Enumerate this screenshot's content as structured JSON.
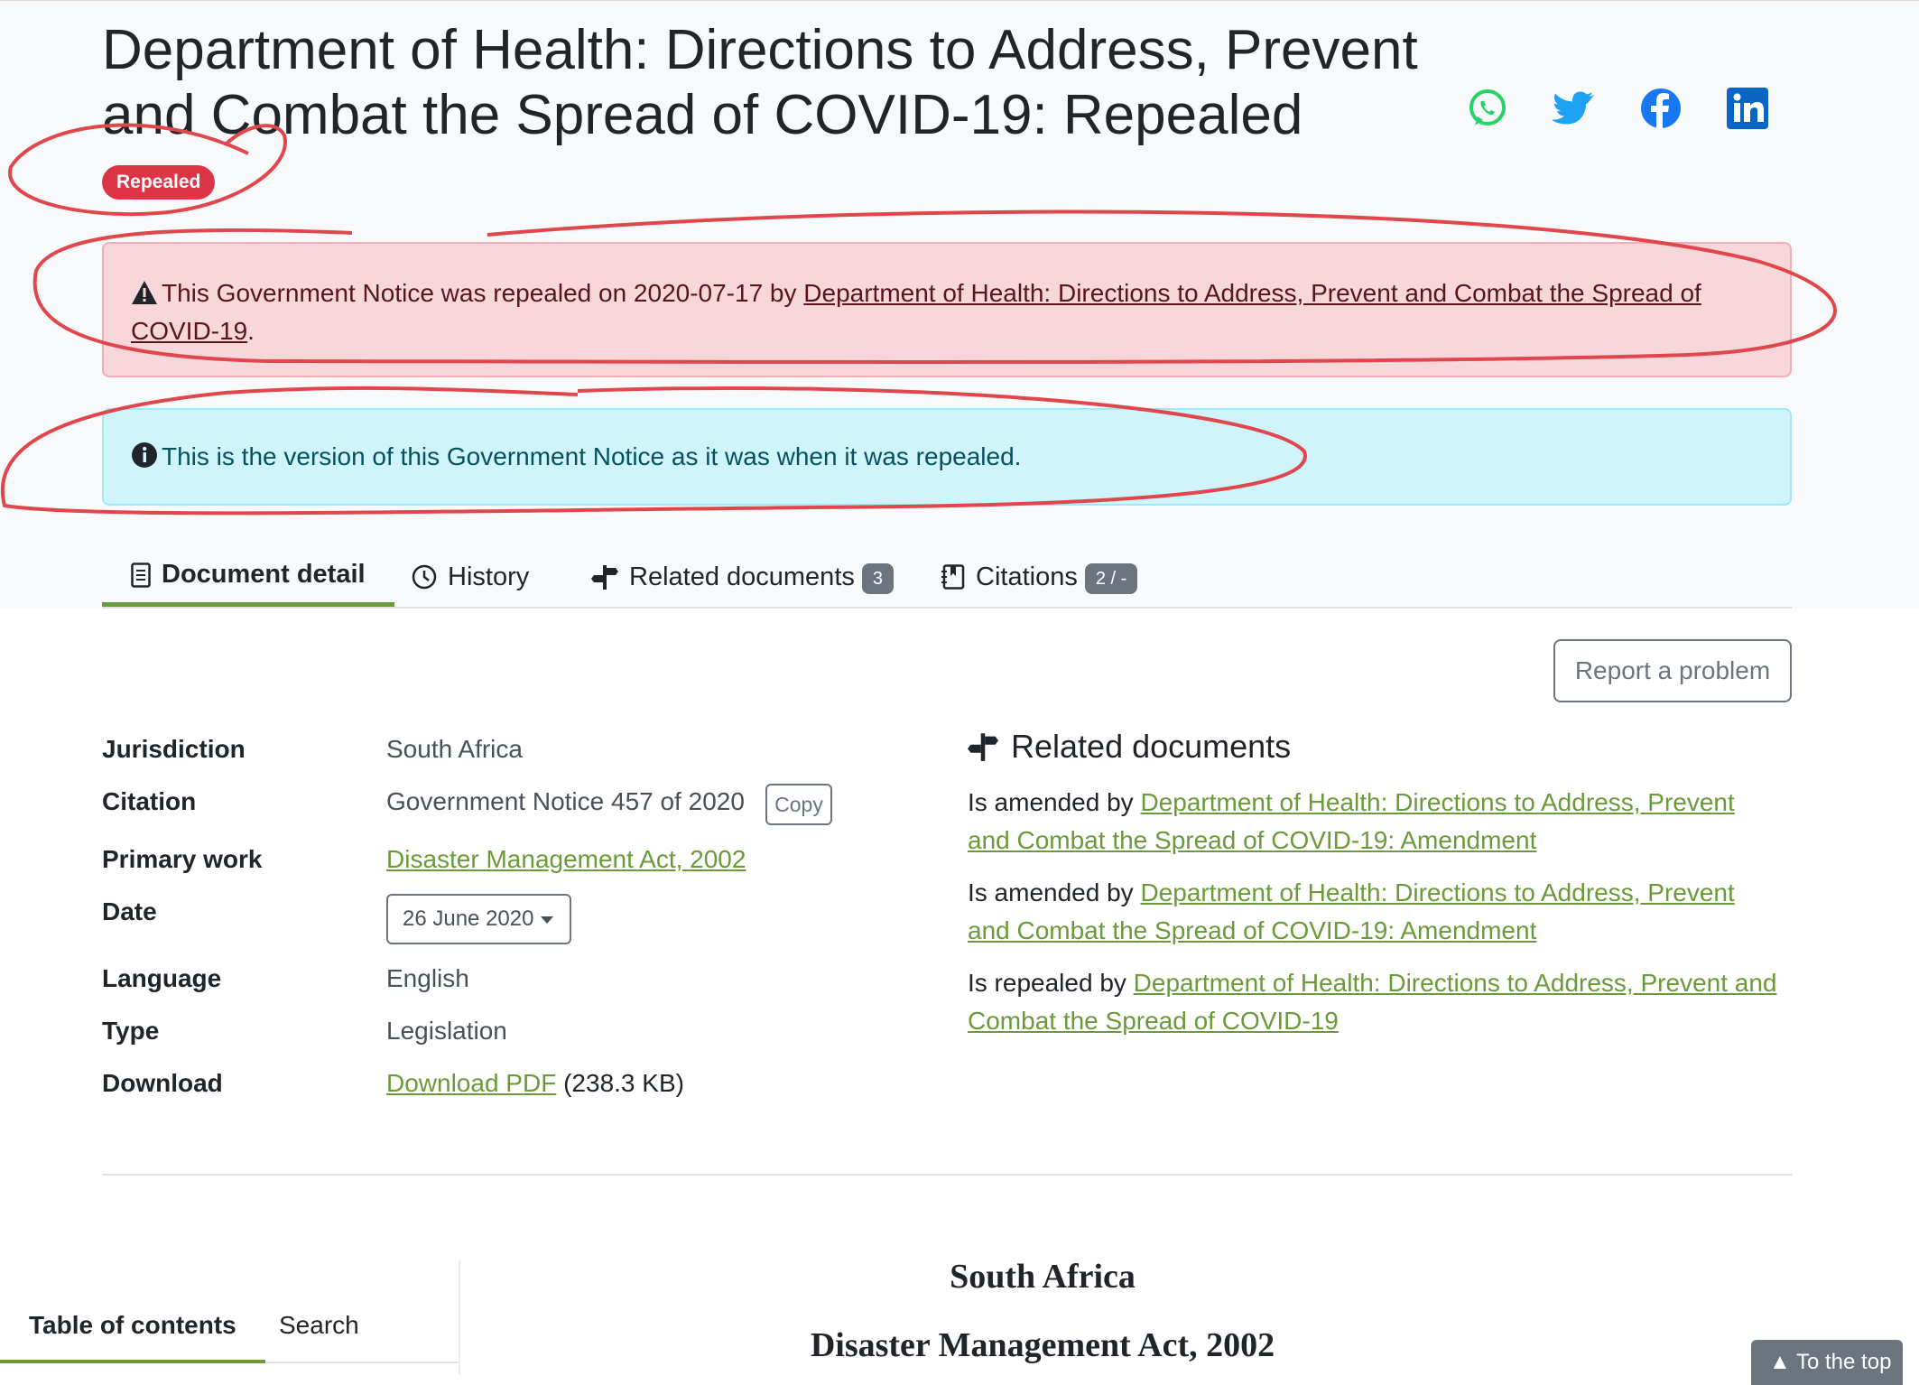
{
  "header": {
    "title": "Department of Health: Directions to Address, Prevent and Combat the Spread of COVID-19: Repealed",
    "status_badge": "Repealed"
  },
  "share": {
    "icons": [
      "whatsapp-icon",
      "twitter-icon",
      "facebook-icon",
      "linkedin-icon"
    ],
    "colors": {
      "whatsapp": "#25d366",
      "twitter": "#1da1f2",
      "facebook": "#1877f2",
      "linkedin": "#0a66c2"
    }
  },
  "alerts": {
    "repealed_prefix": "This Government Notice was repealed on 2020-07-17 by ",
    "repealed_link": "Department of Health: Directions to Address, Prevent and Combat the Spread of COVID-19",
    "repealed_suffix": ".",
    "version_info": "This is the version of this Government Notice as it was when it was repealed."
  },
  "tabs": [
    {
      "label": "Document detail",
      "icon": "document-icon",
      "active": true
    },
    {
      "label": "History",
      "icon": "clock-icon"
    },
    {
      "label": "Related documents",
      "icon": "signpost-icon",
      "count": "3"
    },
    {
      "label": "Citations",
      "icon": "journal-icon",
      "count": "2 / -"
    }
  ],
  "report_button": "Report a problem",
  "details": {
    "jurisdiction_label": "Jurisdiction",
    "jurisdiction": "South Africa",
    "citation_label": "Citation",
    "citation": "Government Notice 457 of 2020",
    "copy_button": "Copy",
    "primary_work_label": "Primary work",
    "primary_work": "Disaster Management Act, 2002",
    "date_label": "Date",
    "date": "26 June 2020",
    "language_label": "Language",
    "language": "English",
    "type_label": "Type",
    "type": "Legislation",
    "download_label": "Download",
    "download_link": "Download PDF",
    "download_size": "(238.3 KB)"
  },
  "related": {
    "heading": "Related documents",
    "items": [
      {
        "prefix": "Is amended by ",
        "link": "Department of Health: Directions to Address, Prevent and Combat the Spread of COVID-19: Amendment"
      },
      {
        "prefix": "Is amended by ",
        "link": "Department of Health: Directions to Address, Prevent and Combat the Spread of COVID-19: Amendment"
      },
      {
        "prefix": "Is repealed by ",
        "link": "Department of Health: Directions to Address, Prevent and Combat the Spread of COVID-19"
      }
    ]
  },
  "toc": {
    "tab_toc": "Table of contents",
    "tab_search": "Search"
  },
  "document_body": {
    "country": "South Africa",
    "act": "Disaster Management Act, 2002"
  },
  "to_top": "To the top",
  "colors": {
    "accent_green": "#6a9a3a",
    "annotation_red": "#e0474c"
  }
}
